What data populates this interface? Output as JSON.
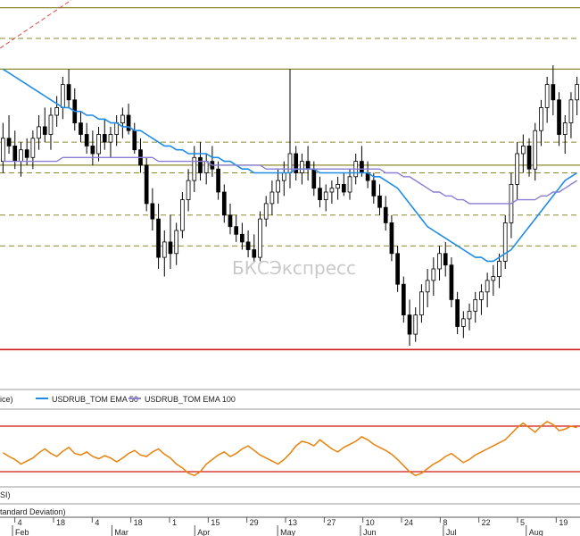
{
  "chart_data": [
    {
      "type": "candlestick",
      "title": "",
      "x_tick_labels": [
        "4",
        "18",
        "4",
        "18",
        "1",
        "15",
        "29",
        "13",
        "27",
        "10",
        "24",
        "8",
        "22",
        "5",
        "19"
      ],
      "month_labels": [
        "Feb",
        "Mar",
        "Apr",
        "May",
        "Jun",
        "Jul",
        "Aug"
      ],
      "y_scale": "linear (no price axis visible)",
      "horizontal_levels": {
        "solid_olive": [
          0.98,
          0.82,
          0.57
        ],
        "dashed_olive": [
          0.9,
          0.63,
          0.55,
          0.44,
          0.36
        ],
        "solid_red": 0.09
      },
      "ohlc": [
        [
          0.58,
          0.68,
          0.55,
          0.64
        ],
        [
          0.64,
          0.7,
          0.6,
          0.62
        ],
        [
          0.62,
          0.66,
          0.56,
          0.58
        ],
        [
          0.58,
          0.63,
          0.54,
          0.61
        ],
        [
          0.61,
          0.64,
          0.57,
          0.59
        ],
        [
          0.59,
          0.66,
          0.56,
          0.64
        ],
        [
          0.64,
          0.7,
          0.61,
          0.67
        ],
        [
          0.67,
          0.72,
          0.63,
          0.65
        ],
        [
          0.65,
          0.72,
          0.61,
          0.7
        ],
        [
          0.7,
          0.75,
          0.67,
          0.72
        ],
        [
          0.72,
          0.8,
          0.69,
          0.78
        ],
        [
          0.78,
          0.82,
          0.72,
          0.74
        ],
        [
          0.74,
          0.77,
          0.66,
          0.68
        ],
        [
          0.68,
          0.71,
          0.63,
          0.65
        ],
        [
          0.65,
          0.68,
          0.6,
          0.62
        ],
        [
          0.62,
          0.66,
          0.57,
          0.6
        ],
        [
          0.6,
          0.67,
          0.58,
          0.65
        ],
        [
          0.65,
          0.69,
          0.61,
          0.63
        ],
        [
          0.63,
          0.67,
          0.59,
          0.65
        ],
        [
          0.65,
          0.7,
          0.62,
          0.68
        ],
        [
          0.68,
          0.72,
          0.64,
          0.7
        ],
        [
          0.7,
          0.73,
          0.65,
          0.66
        ],
        [
          0.66,
          0.68,
          0.6,
          0.61
        ],
        [
          0.61,
          0.64,
          0.55,
          0.57
        ],
        [
          0.57,
          0.59,
          0.45,
          0.47
        ],
        [
          0.47,
          0.51,
          0.4,
          0.43
        ],
        [
          0.43,
          0.47,
          0.3,
          0.33
        ],
        [
          0.33,
          0.4,
          0.28,
          0.37
        ],
        [
          0.37,
          0.44,
          0.3,
          0.34
        ],
        [
          0.34,
          0.42,
          0.31,
          0.4
        ],
        [
          0.4,
          0.5,
          0.38,
          0.48
        ],
        [
          0.48,
          0.56,
          0.45,
          0.53
        ],
        [
          0.53,
          0.62,
          0.5,
          0.59
        ],
        [
          0.59,
          0.63,
          0.53,
          0.55
        ],
        [
          0.55,
          0.6,
          0.52,
          0.58
        ],
        [
          0.58,
          0.62,
          0.54,
          0.56
        ],
        [
          0.56,
          0.58,
          0.48,
          0.5
        ],
        [
          0.5,
          0.52,
          0.42,
          0.44
        ],
        [
          0.44,
          0.47,
          0.39,
          0.41
        ],
        [
          0.41,
          0.44,
          0.37,
          0.39
        ],
        [
          0.39,
          0.42,
          0.35,
          0.37
        ],
        [
          0.37,
          0.4,
          0.33,
          0.35
        ],
        [
          0.35,
          0.39,
          0.32,
          0.33
        ],
        [
          0.33,
          0.45,
          0.32,
          0.43
        ],
        [
          0.43,
          0.49,
          0.41,
          0.47
        ],
        [
          0.47,
          0.53,
          0.44,
          0.5
        ],
        [
          0.5,
          0.56,
          0.47,
          0.53
        ],
        [
          0.53,
          0.58,
          0.49,
          0.55
        ],
        [
          0.55,
          0.82,
          0.51,
          0.6
        ],
        [
          0.6,
          0.62,
          0.53,
          0.55
        ],
        [
          0.55,
          0.6,
          0.52,
          0.58
        ],
        [
          0.58,
          0.62,
          0.53,
          0.56
        ],
        [
          0.56,
          0.58,
          0.49,
          0.51
        ],
        [
          0.51,
          0.54,
          0.46,
          0.48
        ],
        [
          0.48,
          0.52,
          0.45,
          0.5
        ],
        [
          0.5,
          0.53,
          0.47,
          0.51
        ],
        [
          0.51,
          0.54,
          0.48,
          0.52
        ],
        [
          0.52,
          0.55,
          0.49,
          0.5
        ],
        [
          0.5,
          0.56,
          0.48,
          0.54
        ],
        [
          0.54,
          0.6,
          0.52,
          0.58
        ],
        [
          0.58,
          0.62,
          0.54,
          0.55
        ],
        [
          0.55,
          0.58,
          0.51,
          0.53
        ],
        [
          0.53,
          0.55,
          0.47,
          0.49
        ],
        [
          0.49,
          0.52,
          0.44,
          0.46
        ],
        [
          0.46,
          0.49,
          0.4,
          0.42
        ],
        [
          0.42,
          0.44,
          0.32,
          0.34
        ],
        [
          0.34,
          0.36,
          0.24,
          0.26
        ],
        [
          0.26,
          0.28,
          0.16,
          0.18
        ],
        [
          0.18,
          0.22,
          0.1,
          0.13
        ],
        [
          0.13,
          0.2,
          0.11,
          0.18
        ],
        [
          0.18,
          0.26,
          0.16,
          0.24
        ],
        [
          0.24,
          0.3,
          0.2,
          0.27
        ],
        [
          0.27,
          0.33,
          0.23,
          0.3
        ],
        [
          0.3,
          0.36,
          0.27,
          0.34
        ],
        [
          0.34,
          0.37,
          0.28,
          0.31
        ],
        [
          0.31,
          0.33,
          0.2,
          0.22
        ],
        [
          0.22,
          0.24,
          0.13,
          0.15
        ],
        [
          0.15,
          0.19,
          0.12,
          0.17
        ],
        [
          0.17,
          0.21,
          0.14,
          0.19
        ],
        [
          0.19,
          0.24,
          0.16,
          0.22
        ],
        [
          0.22,
          0.26,
          0.18,
          0.24
        ],
        [
          0.24,
          0.29,
          0.2,
          0.27
        ],
        [
          0.27,
          0.31,
          0.23,
          0.28
        ],
        [
          0.28,
          0.34,
          0.25,
          0.32
        ],
        [
          0.32,
          0.44,
          0.3,
          0.42
        ],
        [
          0.42,
          0.55,
          0.38,
          0.52
        ],
        [
          0.52,
          0.63,
          0.48,
          0.6
        ],
        [
          0.6,
          0.65,
          0.55,
          0.62
        ],
        [
          0.62,
          0.64,
          0.54,
          0.56
        ],
        [
          0.56,
          0.68,
          0.53,
          0.66
        ],
        [
          0.66,
          0.74,
          0.62,
          0.72
        ],
        [
          0.72,
          0.8,
          0.68,
          0.78
        ],
        [
          0.78,
          0.83,
          0.7,
          0.74
        ],
        [
          0.74,
          0.76,
          0.62,
          0.65
        ],
        [
          0.65,
          0.7,
          0.6,
          0.68
        ],
        [
          0.68,
          0.76,
          0.64,
          0.74
        ],
        [
          0.74,
          0.8,
          0.7,
          0.78
        ]
      ],
      "series": [
        {
          "name": "USDRUB_TOM EMA 50",
          "color": "#1f8ce6",
          "values": [
            0.82,
            0.81,
            0.8,
            0.79,
            0.78,
            0.77,
            0.76,
            0.75,
            0.74,
            0.73,
            0.72,
            0.72,
            0.71,
            0.71,
            0.7,
            0.7,
            0.69,
            0.69,
            0.68,
            0.68,
            0.67,
            0.67,
            0.66,
            0.66,
            0.65,
            0.64,
            0.63,
            0.62,
            0.62,
            0.61,
            0.61,
            0.6,
            0.6,
            0.6,
            0.6,
            0.59,
            0.59,
            0.58,
            0.58,
            0.57,
            0.56,
            0.56,
            0.55,
            0.55,
            0.55,
            0.55,
            0.55,
            0.55,
            0.55,
            0.56,
            0.56,
            0.56,
            0.56,
            0.55,
            0.55,
            0.55,
            0.55,
            0.55,
            0.55,
            0.55,
            0.55,
            0.55,
            0.54,
            0.54,
            0.53,
            0.52,
            0.51,
            0.49,
            0.47,
            0.45,
            0.43,
            0.41,
            0.4,
            0.39,
            0.38,
            0.37,
            0.36,
            0.35,
            0.34,
            0.33,
            0.33,
            0.32,
            0.32,
            0.33,
            0.34,
            0.35,
            0.37,
            0.39,
            0.41,
            0.43,
            0.45,
            0.47,
            0.49,
            0.51,
            0.53,
            0.54,
            0.55
          ]
        },
        {
          "name": "USDRUB_TOM EMA 100",
          "color": "#8a7fd4",
          "values": [
            0.58,
            0.58,
            0.58,
            0.58,
            0.58,
            0.58,
            0.58,
            0.58,
            0.58,
            0.58,
            0.59,
            0.59,
            0.59,
            0.59,
            0.59,
            0.59,
            0.59,
            0.59,
            0.59,
            0.59,
            0.59,
            0.59,
            0.59,
            0.59,
            0.59,
            0.59,
            0.58,
            0.58,
            0.58,
            0.58,
            0.58,
            0.58,
            0.58,
            0.58,
            0.58,
            0.57,
            0.57,
            0.57,
            0.57,
            0.57,
            0.57,
            0.57,
            0.57,
            0.57,
            0.56,
            0.56,
            0.56,
            0.56,
            0.56,
            0.56,
            0.56,
            0.56,
            0.56,
            0.56,
            0.56,
            0.56,
            0.56,
            0.56,
            0.56,
            0.56,
            0.56,
            0.56,
            0.56,
            0.56,
            0.55,
            0.55,
            0.55,
            0.54,
            0.54,
            0.53,
            0.52,
            0.51,
            0.5,
            0.5,
            0.49,
            0.49,
            0.48,
            0.48,
            0.47,
            0.47,
            0.47,
            0.47,
            0.47,
            0.47,
            0.47,
            0.47,
            0.48,
            0.48,
            0.48,
            0.48,
            0.49,
            0.49,
            0.5,
            0.5,
            0.51,
            0.52,
            0.53
          ]
        }
      ],
      "legend_partial_text": "ice)",
      "watermark": "БКСЭкспресс"
    },
    {
      "type": "line",
      "title": "",
      "indicator_partial_label": "SI)",
      "bands": [
        0.8,
        0.2
      ],
      "series": [
        {
          "name": "",
          "color": "#e8820c",
          "values": [
            0.45,
            0.4,
            0.36,
            0.3,
            0.34,
            0.38,
            0.45,
            0.5,
            0.44,
            0.4,
            0.47,
            0.52,
            0.44,
            0.42,
            0.46,
            0.4,
            0.37,
            0.41,
            0.38,
            0.33,
            0.38,
            0.44,
            0.48,
            0.42,
            0.4,
            0.46,
            0.5,
            0.43,
            0.38,
            0.3,
            0.25,
            0.18,
            0.15,
            0.2,
            0.3,
            0.36,
            0.42,
            0.46,
            0.4,
            0.44,
            0.5,
            0.54,
            0.48,
            0.42,
            0.38,
            0.34,
            0.3,
            0.36,
            0.44,
            0.54,
            0.6,
            0.58,
            0.54,
            0.62,
            0.56,
            0.5,
            0.46,
            0.52,
            0.56,
            0.6,
            0.66,
            0.62,
            0.56,
            0.52,
            0.48,
            0.43,
            0.36,
            0.28,
            0.2,
            0.15,
            0.18,
            0.24,
            0.3,
            0.34,
            0.4,
            0.44,
            0.38,
            0.32,
            0.36,
            0.42,
            0.46,
            0.5,
            0.54,
            0.58,
            0.62,
            0.7,
            0.78,
            0.84,
            0.78,
            0.72,
            0.8,
            0.86,
            0.82,
            0.74,
            0.76,
            0.8,
            0.78
          ]
        }
      ]
    }
  ],
  "lower_legend_partial_text": "tandard Deviation)",
  "colors": {
    "candle_up": "#ffffff",
    "candle_down": "#000000",
    "level_olive": "#8a8a2a",
    "level_red": "#d01818",
    "trend_red": "#e24a4a"
  }
}
